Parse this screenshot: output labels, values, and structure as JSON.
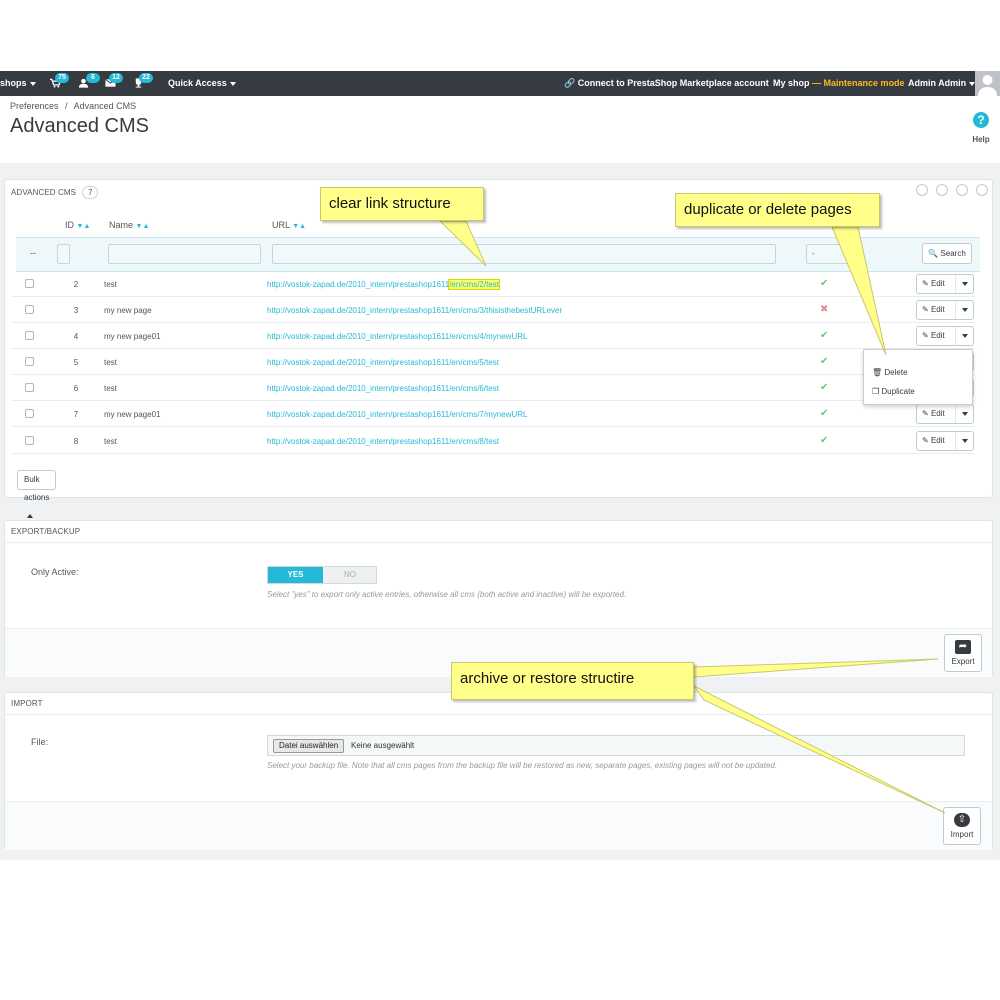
{
  "topbar": {
    "shops_label": "shops",
    "badges": [
      "75",
      "6",
      "12",
      "22"
    ],
    "quick_access": "Quick Access",
    "marketplace": "Connect to PrestaShop Marketplace account",
    "shop_name": "My shop",
    "dash": "—",
    "maintenance": "Maintenance mode",
    "admin": "Admin Admin"
  },
  "breadcrumb": {
    "parent": "Preferences",
    "separator": "/",
    "current": "Advanced CMS"
  },
  "page_title": "Advanced CMS",
  "help_label": "Help",
  "list": {
    "heading": "ADVANCED CMS",
    "count": "7",
    "columns": {
      "id": "ID",
      "name": "Name",
      "url": "URL"
    },
    "sort_icons": "▼▲",
    "filter_dash": "--",
    "filter_select": "-",
    "search_label": "Search",
    "edit_label": "Edit",
    "rows": [
      {
        "id": "2",
        "name": "test",
        "url_base": "http://vostok-zapad.de/2010_intern/prestashop1611",
        "url_path": "/en/cms/2/test",
        "active": "✔"
      },
      {
        "id": "3",
        "name": "my new page",
        "url_base": "http://vostok-zapad.de/2010_intern/prestashop1611",
        "url_path": "/en/cms/3/thisisthebestURLever",
        "active": "✖"
      },
      {
        "id": "4",
        "name": "my new page01",
        "url_base": "http://vostok-zapad.de/2010_intern/prestashop1611",
        "url_path": "/en/cms/4/mynewURL",
        "active": "✔"
      },
      {
        "id": "5",
        "name": "test",
        "url_base": "http://vostok-zapad.de/2010_intern/prestashop1611",
        "url_path": "/en/cms/5/test",
        "active": "✔"
      },
      {
        "id": "6",
        "name": "test",
        "url_base": "http://vostok-zapad.de/2010_intern/prestashop1611",
        "url_path": "/en/cms/6/test",
        "active": "✔"
      },
      {
        "id": "7",
        "name": "my new page01",
        "url_base": "http://vostok-zapad.de/2010_intern/prestashop1611",
        "url_path": "/en/cms/7/mynewURL",
        "active": "✔"
      },
      {
        "id": "8",
        "name": "test",
        "url_base": "http://vostok-zapad.de/2010_intern/prestashop1611",
        "url_path": "/en/cms/8/test",
        "active": "✔"
      }
    ],
    "dropdown": {
      "delete": "Delete",
      "duplicate": "Duplicate"
    },
    "bulk_actions": "Bulk actions"
  },
  "export": {
    "heading": "EXPORT/BACKUP",
    "only_active_label": "Only Active:",
    "yes": "YES",
    "no": "NO",
    "help": "Select \"yes\" to export only active entries, otherwise all cms (both active and inactive) will be exported.",
    "button": "Export"
  },
  "import": {
    "heading": "IMPORT",
    "file_label": "File:",
    "choose_file": "Datei auswählen",
    "no_file": "Keine ausgewählt",
    "help": "Select your backup file. Note that all cms pages from the backup file will be restored as new, separate pages, existing pages will not be updated.",
    "button": "Import"
  },
  "callouts": {
    "link_structure": "clear link structure",
    "duplicate_delete": "duplicate or delete pages",
    "archive_restore": "archive or restore structire"
  },
  "colors": {
    "topbar": "#363a41",
    "accent": "#25b9d7",
    "maintenance": "#fbbb22",
    "callout": "#ffff8a",
    "active_ok": "#72c279",
    "active_no": "#e08f95"
  }
}
